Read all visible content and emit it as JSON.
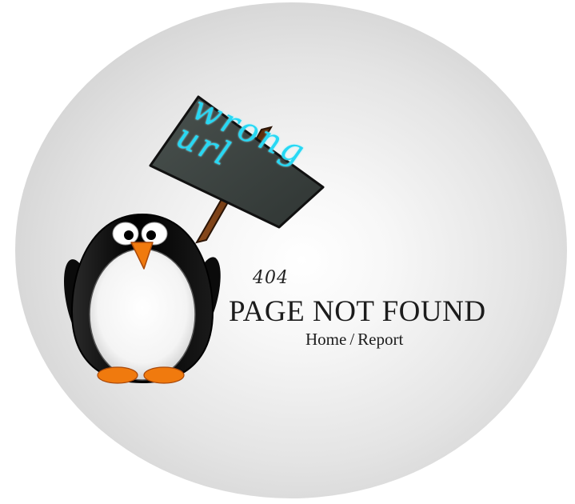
{
  "sign": {
    "line1": "wrong",
    "line2": "url"
  },
  "error": {
    "code": "404",
    "title": "PAGE NOT FOUND"
  },
  "links": {
    "home": "Home",
    "separator": "/",
    "report": "Report"
  },
  "colors": {
    "sign_text": "#27d8f4",
    "beak_feet": "#f07a0e",
    "background_disc": "#e4e4e4"
  }
}
